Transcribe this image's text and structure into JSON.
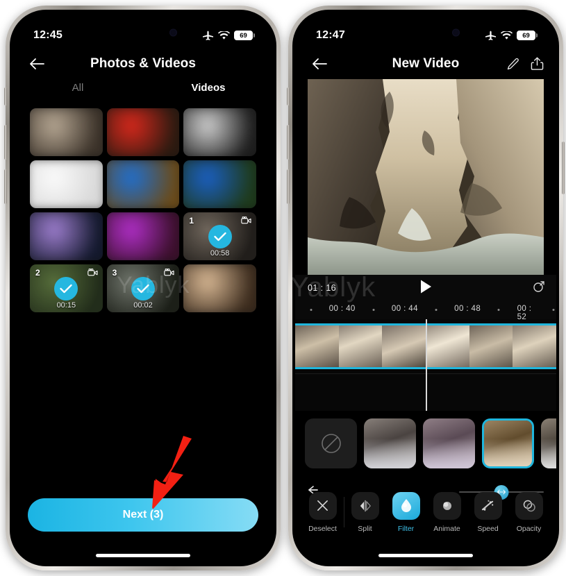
{
  "left_phone": {
    "status": {
      "time": "12:45",
      "airplane_icon": "airplane-mode-icon",
      "wifi_icon": "wifi-icon",
      "battery_level": "69"
    },
    "nav": {
      "back_icon": "back-arrow-icon",
      "title": "Photos & Videos"
    },
    "tabs": [
      {
        "label": "All",
        "active": false
      },
      {
        "label": "Videos",
        "active": true
      }
    ],
    "grid": [
      {
        "selected": false,
        "color_a": "#b7a894",
        "color_b": "#3a3128",
        "duration": ""
      },
      {
        "selected": false,
        "color_a": "#d8281c",
        "color_b": "#2a1a10",
        "duration": ""
      },
      {
        "selected": false,
        "color_a": "#cfcfcf",
        "color_b": "#1d1d1d",
        "duration": ""
      },
      {
        "selected": false,
        "color_a": "#fbfbfb",
        "color_b": "#d8d8d8",
        "duration": ""
      },
      {
        "selected": false,
        "color_a": "#1f6fd0",
        "color_b": "#6a4a18",
        "duration": ""
      },
      {
        "selected": false,
        "color_a": "#1a5fc4",
        "color_b": "#1e3a1a",
        "duration": ""
      },
      {
        "selected": false,
        "color_a": "#9f7fd0",
        "color_b": "#12182c",
        "duration": ""
      },
      {
        "selected": false,
        "color_a": "#b02fc8",
        "color_b": "#3a0f2a",
        "duration": ""
      },
      {
        "selected": true,
        "color_a": "#8d8174",
        "color_b": "#2a2622",
        "duration": "00:58",
        "number": "1",
        "badge_icon": "video-camera-icon",
        "check_icon": "check-icon"
      },
      {
        "selected": true,
        "color_a": "#6d8a4a",
        "color_b": "#2c3a22",
        "duration": "00:15",
        "number": "2",
        "badge_icon": "video-camera-icon",
        "check_icon": "check-icon"
      },
      {
        "selected": true,
        "color_a": "#8d9488",
        "color_b": "#24281f",
        "duration": "00:02",
        "number": "3",
        "badge_icon": "video-camera-icon",
        "check_icon": "check-icon"
      },
      {
        "selected": false,
        "color_a": "#d8b894",
        "color_b": "#3a2a1c",
        "duration": ""
      }
    ],
    "next_button": {
      "label": "Next (3)",
      "gradient_start": "#1bb4e3",
      "gradient_end": "#86dcf5"
    },
    "annotation_arrow": {
      "color": "#f32013",
      "name": "red-pointer-arrow"
    }
  },
  "right_phone": {
    "status": {
      "time": "12:47",
      "airplane_icon": "airplane-mode-icon",
      "wifi_icon": "wifi-icon",
      "battery_level": "69"
    },
    "nav": {
      "back_icon": "back-arrow-icon",
      "title": "New Video",
      "edit_icon": "pencil-icon",
      "share_icon": "share-icon"
    },
    "player": {
      "time": "01 : 16",
      "play_icon": "play-icon",
      "fullscreen_icon": "fullscreen-icon"
    },
    "ruler": {
      "labels": [
        "00 : 40",
        "00 : 44",
        "00 : 48",
        "00 : 52"
      ],
      "label_positions": [
        18,
        42,
        66,
        90
      ],
      "dot_positions": [
        6,
        30,
        54,
        78,
        99
      ]
    },
    "timeline": {
      "clip_border_color": "#1fb6dd",
      "playhead_name": "playhead"
    },
    "filters": [
      {
        "name": "none",
        "selected": false,
        "icon": "no-filter-icon"
      },
      {
        "name": "filter-1",
        "selected": false,
        "tint": "rgba(120,120,140,0.25)"
      },
      {
        "name": "filter-2",
        "selected": false,
        "tint": "rgba(150,120,170,0.35)"
      },
      {
        "name": "filter-3",
        "selected": true,
        "tint": "rgba(190,140,60,0.30)"
      },
      {
        "name": "filter-4",
        "selected": false,
        "tint": "rgba(130,130,130,0.15)"
      }
    ],
    "adjust": {
      "undo_icon": "undo-arrow-icon",
      "slider_value": 50,
      "slider_knob_icon": "slider-knob-icon"
    },
    "toolbar": [
      {
        "label": "Deselect",
        "icon": "close-x-icon",
        "active": false
      },
      {
        "label": "Split",
        "icon": "split-icon",
        "active": false
      },
      {
        "label": "Filter",
        "icon": "filter-drop-icon",
        "active": true
      },
      {
        "label": "Animate",
        "icon": "animate-circle-icon",
        "active": false
      },
      {
        "label": "Speed",
        "icon": "speed-sparkle-icon",
        "active": false
      },
      {
        "label": "Opacity",
        "icon": "opacity-circles-icon",
        "active": false
      }
    ],
    "accent_color": "#1fb6dd"
  },
  "watermark": {
    "text": "Yablyk"
  }
}
